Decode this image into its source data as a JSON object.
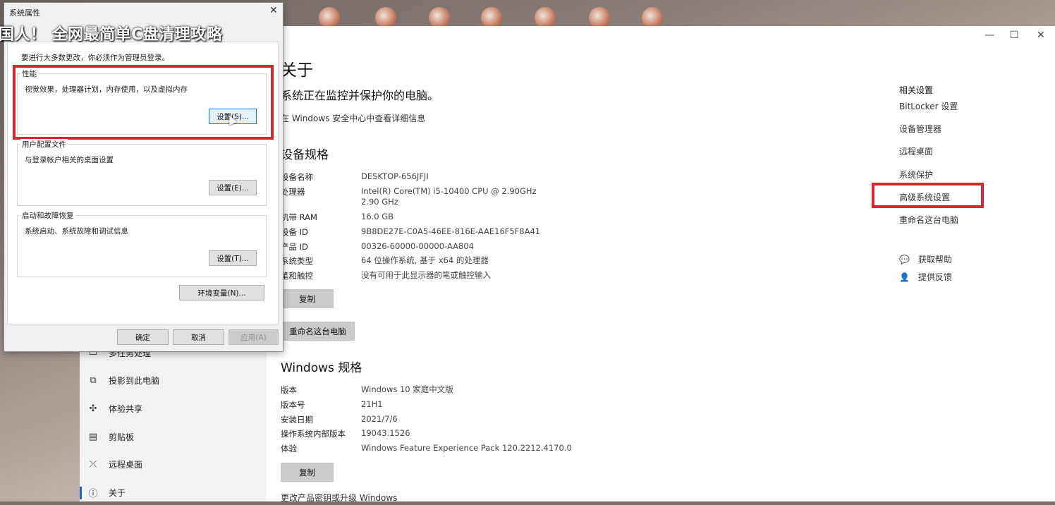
{
  "overlay": {
    "title": "国人！ 全网最简单C盘清理攻略"
  },
  "settings": {
    "window_controls": {
      "minimize": "—",
      "maximize": "☐",
      "close": "✕"
    },
    "sidebar": {
      "items": [
        {
          "label": "多任务处理",
          "icon": "multitask-icon",
          "glyph": "▭"
        },
        {
          "label": "投影到此电脑",
          "icon": "project-icon",
          "glyph": "⧉"
        },
        {
          "label": "体验共享",
          "icon": "share-icon",
          "glyph": "✣"
        },
        {
          "label": "剪贴板",
          "icon": "clipboard-icon",
          "glyph": "▤"
        },
        {
          "label": "远程桌面",
          "icon": "remote-desktop-icon",
          "glyph": "⤫"
        },
        {
          "label": "关于",
          "icon": "info-icon",
          "glyph": "ⓘ"
        }
      ]
    },
    "main": {
      "title": "关于",
      "protect_status": "系统正在监控并保护你的电脑。",
      "security_link": "在 Windows 安全中心中查看详细信息",
      "device_heading": "设备规格",
      "device_specs": [
        {
          "key": "设备名称",
          "value": "DESKTOP-656JFJI"
        },
        {
          "key": "处理器",
          "value": "Intel(R) Core(TM) i5-10400 CPU @ 2.90GHz   2.90 GHz"
        },
        {
          "key": "机带 RAM",
          "value": "16.0 GB"
        },
        {
          "key": "设备 ID",
          "value": "9B8DE27E-C0A5-46EE-816E-AAE16F5F8A41"
        },
        {
          "key": "产品 ID",
          "value": "00326-60000-00000-AA804"
        },
        {
          "key": "系统类型",
          "value": "64 位操作系统, 基于 x64 的处理器"
        },
        {
          "key": "笔和触控",
          "value": "没有可用于此显示器的笔或触控输入"
        }
      ],
      "copy_label": "复制",
      "rename_label": "重命名这台电脑",
      "windows_heading": "Windows 规格",
      "windows_specs": [
        {
          "key": "版本",
          "value": "Windows 10 家庭中文版"
        },
        {
          "key": "版本号",
          "value": "21H1"
        },
        {
          "key": "安装日期",
          "value": "2021/7/6"
        },
        {
          "key": "操作系统内部版本",
          "value": "19043.1526"
        },
        {
          "key": "体验",
          "value": "Windows Feature Experience Pack 120.2212.4170.0"
        }
      ],
      "copy2_label": "复制",
      "bottom_link": "更改产品密钥或升级 Windows"
    },
    "related": {
      "heading": "相关设置",
      "items": [
        "BitLocker 设置",
        "设备管理器",
        "远程桌面",
        "系统保护",
        "高级系统设置",
        "重命名这台电脑"
      ],
      "help": "获取帮助",
      "feedback": "提供反馈"
    }
  },
  "dialog": {
    "title": "系统属性",
    "close": "✕",
    "admin_note": "要进行大多数更改，你必须作为管理员登录。",
    "performance": {
      "label": "性能",
      "desc": "视觉效果，处理器计划，内存使用，以及虚拟内存",
      "button": "设置(S)..."
    },
    "profile": {
      "label": "用户配置文件",
      "desc": "与登录帐户相关的桌面设置",
      "button": "设置(E)..."
    },
    "startup": {
      "label": "启动和故障恢复",
      "desc": "系统启动、系统故障和调试信息",
      "button": "设置(T)..."
    },
    "env_button": "环境变量(N)...",
    "ok": "确定",
    "cancel": "取消",
    "apply": "应用(A)"
  },
  "colors": {
    "highlight_red": "#d7262f",
    "accent_blue": "#0078d7"
  }
}
